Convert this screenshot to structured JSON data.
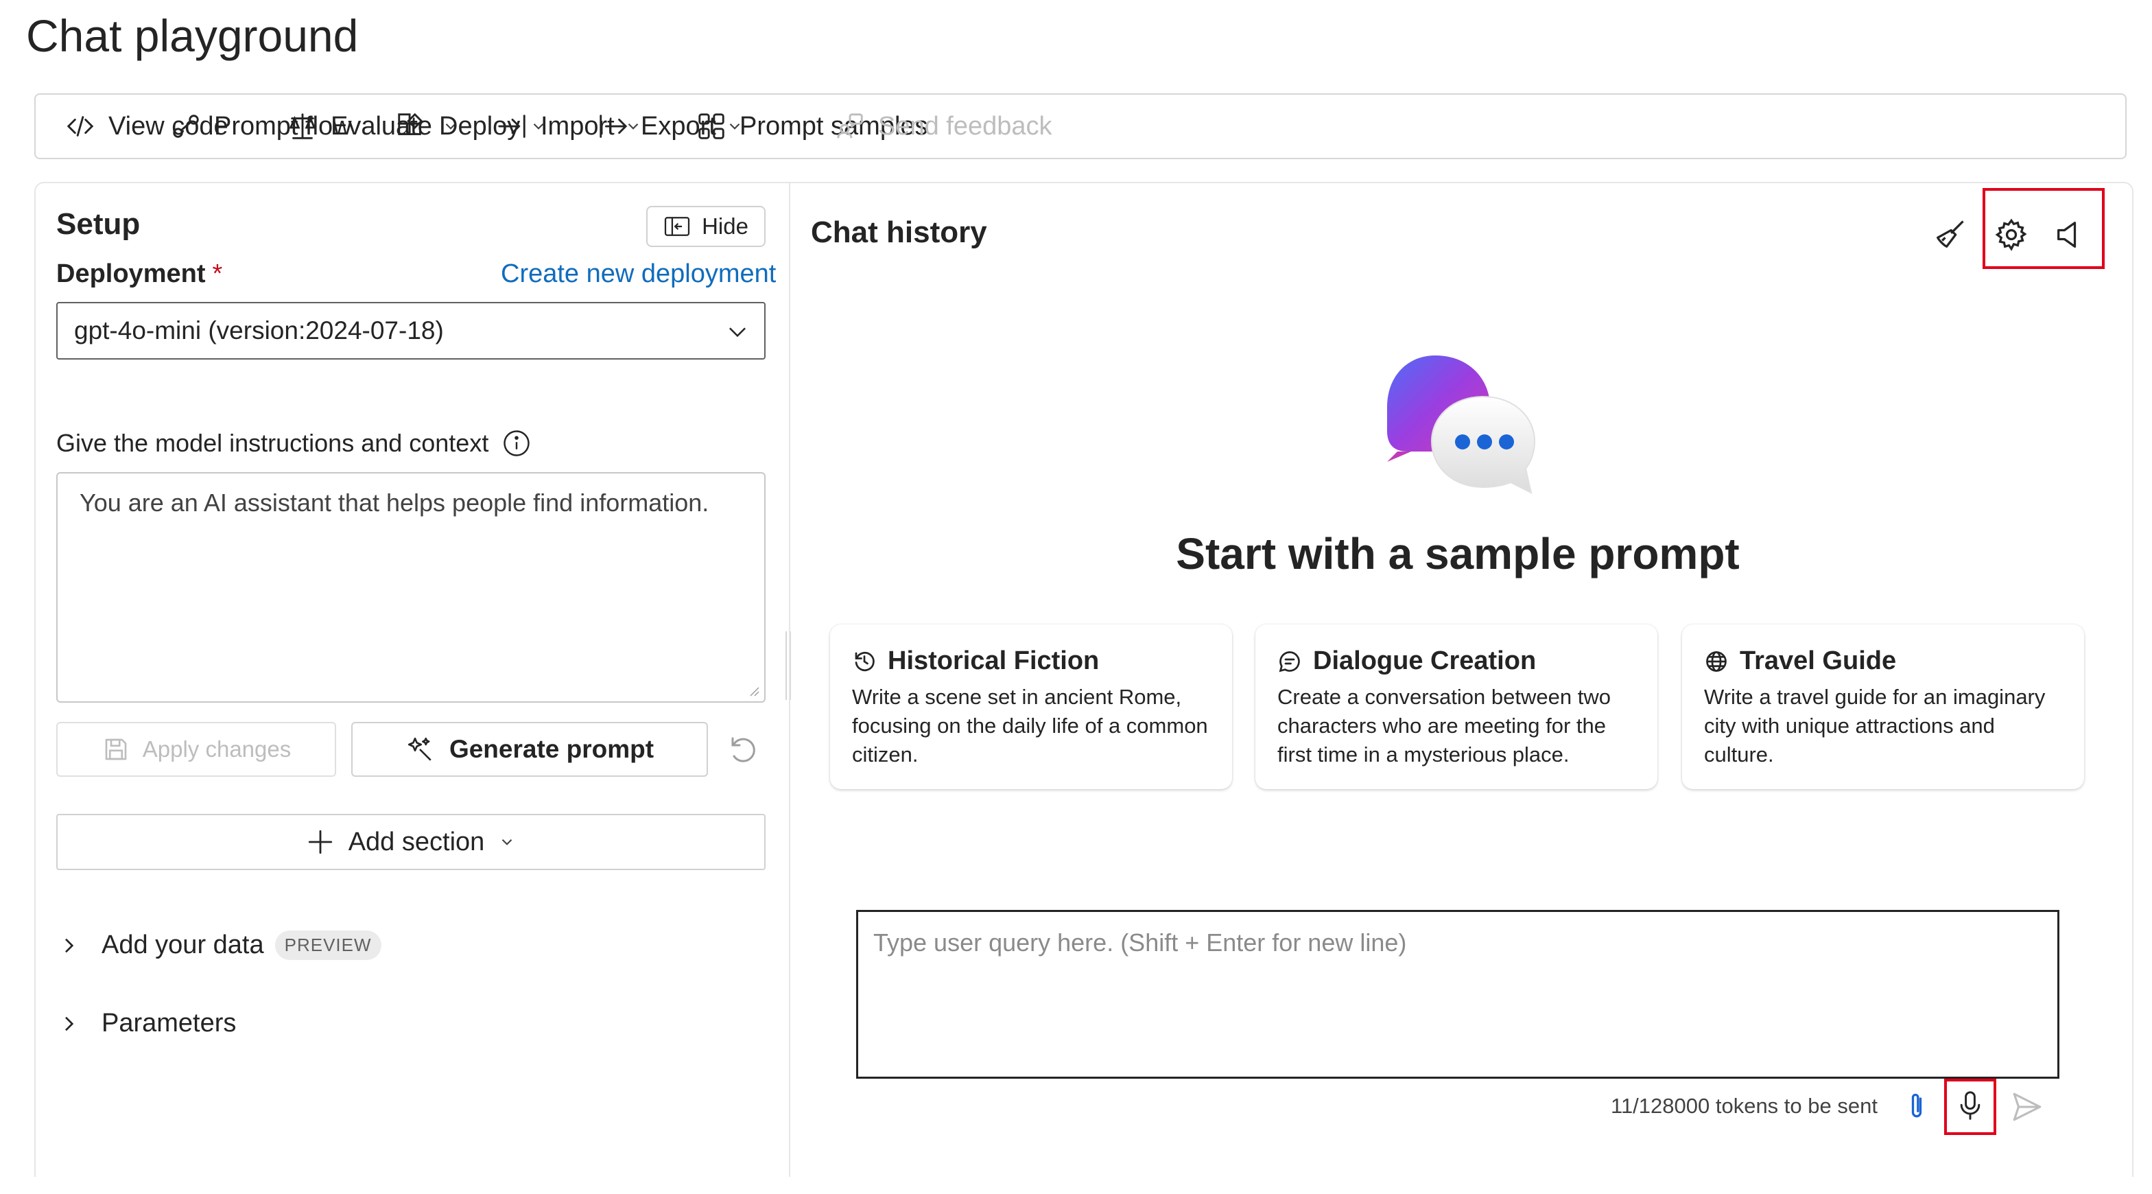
{
  "page": {
    "title": "Chat playground"
  },
  "toolbar": {
    "view_code": "View code",
    "prompt_flow": "Prompt flow",
    "evaluate": "Evaluate",
    "deploy": "Deploy",
    "import": "Import",
    "export": "Export",
    "prompt_samples": "Prompt samples",
    "send_feedback": "Send feedback"
  },
  "setup": {
    "title": "Setup",
    "hide_label": "Hide",
    "deployment_label": "Deployment",
    "required_marker": "*",
    "create_link": "Create new deployment",
    "deployment_value": "gpt-4o-mini (version:2024-07-18)",
    "instructions_label": "Give the model instructions and context",
    "system_message": "You are an AI assistant that helps people find information.",
    "apply_changes_label": "Apply changes",
    "generate_prompt_label": "Generate prompt",
    "add_section_label": "Add section",
    "add_data_label": "Add your data",
    "preview_badge": "PREVIEW",
    "parameters_label": "Parameters"
  },
  "chat": {
    "title": "Chat history",
    "start_heading": "Start with a sample prompt",
    "cards": [
      {
        "title": "Historical Fiction",
        "body": "Write a scene set in ancient Rome, focusing on the daily life of a common citizen.",
        "icon": "history-icon"
      },
      {
        "title": "Dialogue Creation",
        "body": "Create a conversation between two characters who are meeting for the first time in a mysterious place.",
        "icon": "chat-bubble-icon"
      },
      {
        "title": "Travel Guide",
        "body": "Write a travel guide for an imaginary city with unique attractions and culture.",
        "icon": "globe-icon"
      }
    ],
    "input_placeholder": "Type user query here. (Shift + Enter for new line)",
    "token_count": "11/128000 tokens to be sent"
  },
  "colors": {
    "accent": "#0f6cbd",
    "highlight": "#e0001b",
    "required": "#c50f1f"
  }
}
